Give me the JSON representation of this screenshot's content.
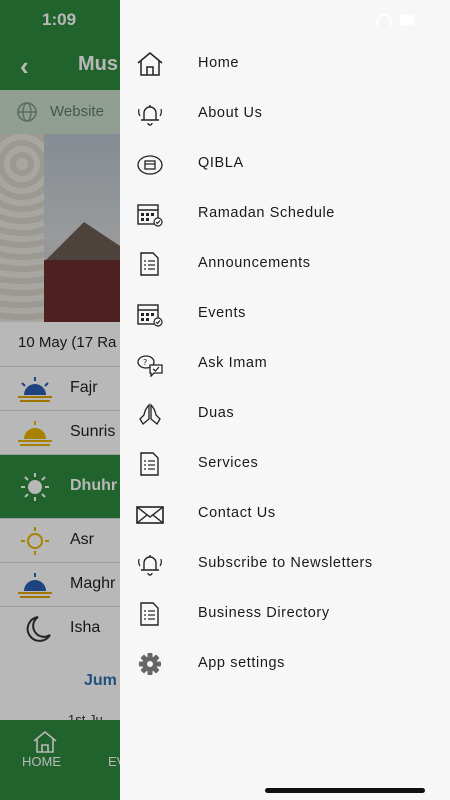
{
  "status": {
    "time": "1:09"
  },
  "app": {
    "title": "Mus",
    "website_label": "Website"
  },
  "date": {
    "text": "10 May (17 Ra"
  },
  "prayers": [
    {
      "name": "Fajr",
      "icon": "sunrise-blue-icon"
    },
    {
      "name": "Sunris",
      "icon": "sunrise-yellow-icon"
    },
    {
      "name": "Dhuhr",
      "icon": "sun-icon"
    },
    {
      "name": "Asr",
      "icon": "sun-yellow-icon"
    },
    {
      "name": "Maghr",
      "icon": "sunset-blue-icon"
    },
    {
      "name": "Isha",
      "icon": "moon-icon"
    }
  ],
  "jumma": {
    "title": "Jum",
    "subtitle": "1st Ju"
  },
  "bottom_nav": {
    "home": "HOME",
    "events": "EV"
  },
  "colors": {
    "brand_green": "#2f8a3d",
    "drawer_bg": "#f7f7f7"
  },
  "drawer": {
    "items": [
      {
        "label": "Home",
        "icon": "home-icon"
      },
      {
        "label": "About Us",
        "icon": "bell-icon"
      },
      {
        "label": "QIBLA",
        "icon": "qibla-icon"
      },
      {
        "label": "Ramadan Schedule",
        "icon": "calendar-icon"
      },
      {
        "label": "Announcements",
        "icon": "checklist-icon"
      },
      {
        "label": "Events",
        "icon": "calendar-icon"
      },
      {
        "label": "Ask Imam",
        "icon": "chat-bubbles-icon"
      },
      {
        "label": "Duas",
        "icon": "praying-hands-icon"
      },
      {
        "label": "Services",
        "icon": "checklist-icon"
      },
      {
        "label": "Contact Us",
        "icon": "envelope-icon"
      },
      {
        "label": "Subscribe to Newsletters",
        "icon": "bell-icon"
      },
      {
        "label": "Business Directory",
        "icon": "checklist-icon"
      },
      {
        "label": "App settings",
        "icon": "gear-icon"
      }
    ]
  }
}
